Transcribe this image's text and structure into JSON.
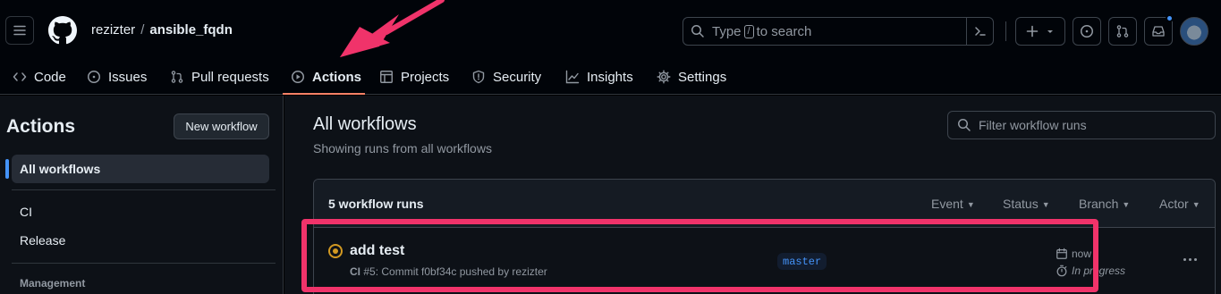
{
  "header": {
    "owner": "rezizter",
    "separator": "/",
    "repo": "ansible_fqdn",
    "search_prefix": "Type",
    "search_key": "/",
    "search_suffix": "to search",
    "plus_label": "+"
  },
  "tabs": [
    {
      "label": "Code",
      "icon": "code-icon"
    },
    {
      "label": "Issues",
      "icon": "issue-icon"
    },
    {
      "label": "Pull requests",
      "icon": "pull-request-icon"
    },
    {
      "label": "Actions",
      "icon": "play-icon",
      "active": true
    },
    {
      "label": "Projects",
      "icon": "table-icon"
    },
    {
      "label": "Security",
      "icon": "shield-icon"
    },
    {
      "label": "Insights",
      "icon": "graph-icon"
    },
    {
      "label": "Settings",
      "icon": "gear-icon"
    }
  ],
  "sidebar": {
    "title": "Actions",
    "new_workflow": "New workflow",
    "items": [
      {
        "label": "All workflows",
        "active": true
      },
      {
        "label": "CI"
      },
      {
        "label": "Release"
      }
    ],
    "section_heading": "Management"
  },
  "main": {
    "title": "All workflows",
    "subtitle": "Showing runs from all workflows",
    "filter_placeholder": "Filter workflow runs",
    "runs_count": "5 workflow runs",
    "filters": [
      "Event",
      "Status",
      "Branch",
      "Actor"
    ],
    "run": {
      "title": "add test",
      "workflow": "CI",
      "meta": "#5: Commit f0bf34c pushed by rezizter",
      "branch": "master",
      "time": "now",
      "duration": "In progress",
      "status": "in-progress"
    }
  },
  "colors": {
    "accent": "#f78166",
    "link": "#4493f8",
    "in_progress": "#d29922",
    "annotation": "#f0336a"
  }
}
